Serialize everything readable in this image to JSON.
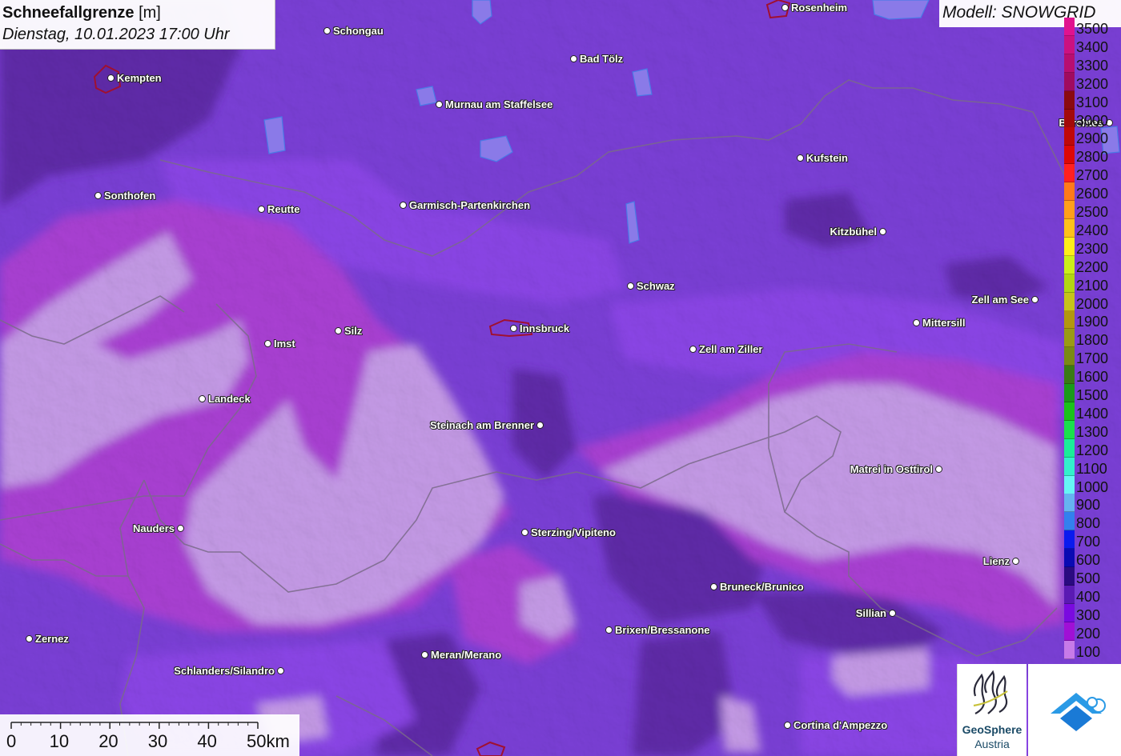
{
  "title": {
    "main": "Schneefallgrenze",
    "unit": "[m]",
    "datetime": "Dienstag, 10.01.2023 17:00 Uhr"
  },
  "model": "Modell: SNOWGRID",
  "legend": [
    {
      "label": "3500",
      "color": "#e0128f"
    },
    {
      "label": "3400",
      "color": "#cc1180"
    },
    {
      "label": "3300",
      "color": "#b80e70"
    },
    {
      "label": "3200",
      "color": "#a00b5f"
    },
    {
      "label": "3100",
      "color": "#8a0a10"
    },
    {
      "label": "3000",
      "color": "#a30a0a"
    },
    {
      "label": "2900",
      "color": "#c00808"
    },
    {
      "label": "2800",
      "color": "#dd0707"
    },
    {
      "label": "2700",
      "color": "#ff2020"
    },
    {
      "label": "2600",
      "color": "#ff7a1a"
    },
    {
      "label": "2500",
      "color": "#ff9f1a"
    },
    {
      "label": "2400",
      "color": "#ffc21a"
    },
    {
      "label": "2300",
      "color": "#ffee1a"
    },
    {
      "label": "2200",
      "color": "#ccef1a"
    },
    {
      "label": "2100",
      "color": "#b3d612"
    },
    {
      "label": "2000",
      "color": "#c7c31a"
    },
    {
      "label": "1900",
      "color": "#b3970f"
    },
    {
      "label": "1800",
      "color": "#9a9a15"
    },
    {
      "label": "1700",
      "color": "#7a8a15"
    },
    {
      "label": "1600",
      "color": "#3a7a15"
    },
    {
      "label": "1500",
      "color": "#1a9a1a"
    },
    {
      "label": "1400",
      "color": "#1ac21a"
    },
    {
      "label": "1300",
      "color": "#1ae04d"
    },
    {
      "label": "1200",
      "color": "#1aee99"
    },
    {
      "label": "1100",
      "color": "#33f0cc"
    },
    {
      "label": "1000",
      "color": "#66f5f5"
    },
    {
      "label": "900",
      "color": "#66b3f0"
    },
    {
      "label": "800",
      "color": "#3380ee"
    },
    {
      "label": "700",
      "color": "#0a1aee"
    },
    {
      "label": "600",
      "color": "#0a0ab3"
    },
    {
      "label": "500",
      "color": "#2a0a80"
    },
    {
      "label": "400",
      "color": "#5a1ab3"
    },
    {
      "label": "300",
      "color": "#7a0ae0"
    },
    {
      "label": "200",
      "color": "#a010d6"
    },
    {
      "label": "100",
      "color": "#c77ae8"
    }
  ],
  "cities": [
    {
      "name": "Rosenheim",
      "side": "right"
    },
    {
      "name": "Schongau",
      "side": "right"
    },
    {
      "name": "Kempten",
      "side": "right"
    },
    {
      "name": "Bad Tölz",
      "side": "right"
    },
    {
      "name": "Murnau am Staffelsee",
      "side": "right"
    },
    {
      "name": "Berchtes",
      "side": "left"
    },
    {
      "name": "Kufstein",
      "side": "right"
    },
    {
      "name": "Sonthofen",
      "side": "right"
    },
    {
      "name": "Reutte",
      "side": "right"
    },
    {
      "name": "Garmisch-Partenkirchen",
      "side": "right"
    },
    {
      "name": "Kitzbühel",
      "side": "left"
    },
    {
      "name": "Schwaz",
      "side": "right"
    },
    {
      "name": "Zell am See",
      "side": "left"
    },
    {
      "name": "Mittersill",
      "side": "right"
    },
    {
      "name": "Silz",
      "side": "right"
    },
    {
      "name": "Innsbruck",
      "side": "right"
    },
    {
      "name": "Imst",
      "side": "right"
    },
    {
      "name": "Zell am Ziller",
      "side": "right"
    },
    {
      "name": "Landeck",
      "side": "right"
    },
    {
      "name": "Steinach am Brenner",
      "side": "left"
    },
    {
      "name": "Matrei in Osttirol",
      "side": "left"
    },
    {
      "name": "Nauders",
      "side": "left"
    },
    {
      "name": "Sterzing/Vipiteno",
      "side": "right"
    },
    {
      "name": "Lienz",
      "side": "left"
    },
    {
      "name": "Bruneck/Brunico",
      "side": "right"
    },
    {
      "name": "Sillian",
      "side": "left"
    },
    {
      "name": "Brixen/Bressanone",
      "side": "right"
    },
    {
      "name": "Zernez",
      "side": "right"
    },
    {
      "name": "Meran/Merano",
      "side": "right"
    },
    {
      "name": "Schlanders/Silandro",
      "side": "left"
    },
    {
      "name": "Cortina d'Ampezzo",
      "side": "right"
    }
  ],
  "scale": {
    "ticks": [
      "0",
      "10",
      "20",
      "30",
      "40",
      "50km"
    ]
  },
  "logos": {
    "geosphere_line1": "GeoSphere",
    "geosphere_line2": "Austria"
  },
  "colors": {
    "class_100": "#c49ae6",
    "class_200": "#a93fd3",
    "class_300": "#8a45e6",
    "class_400": "#7a3fd6",
    "class_500": "#5e2aa8"
  }
}
